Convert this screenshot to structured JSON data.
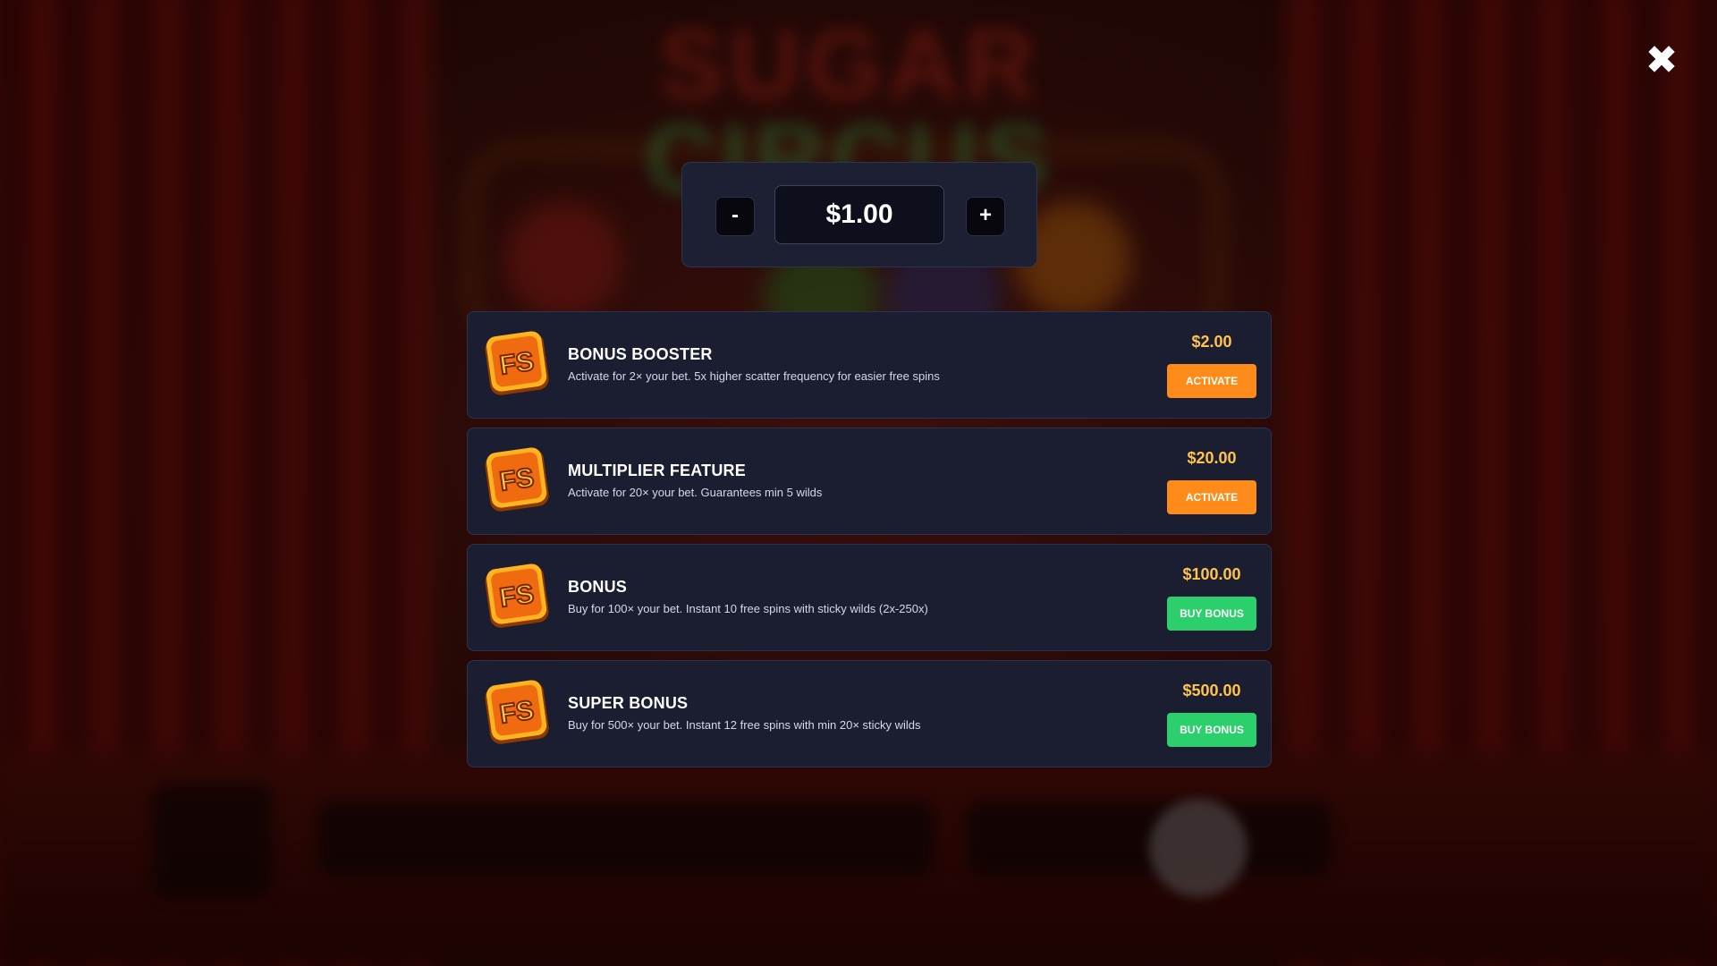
{
  "background": {
    "logo_lines": [
      "SUGAR",
      "CIRCUS"
    ]
  },
  "close": {
    "icon": "close-icon",
    "glyph": "✖"
  },
  "bet": {
    "minus_label": "-",
    "plus_label": "+",
    "value": "$1.00"
  },
  "features": [
    {
      "icon": "fs-icon",
      "icon_text": "FS",
      "title": "BONUS BOOSTER",
      "description": "Activate for 2× your bet. 5x higher scatter frequency for easier free spins",
      "price": "$2.00",
      "button": "ACTIVATE",
      "button_color": "#ff8c1a"
    },
    {
      "icon": "fs-icon",
      "icon_text": "FS",
      "title": "MULTIPLIER FEATURE",
      "description": "Activate for 20× your bet. Guarantees min 5 wilds",
      "price": "$20.00",
      "button": "ACTIVATE",
      "button_color": "#ff8c1a"
    },
    {
      "icon": "fs-icon",
      "icon_text": "FS",
      "title": "BONUS",
      "description": "Buy for 100× your bet. Instant 10 free spins with sticky wilds (2x-250x)",
      "price": "$100.00",
      "button": "BUY BONUS",
      "button_color": "#2bcf6c"
    },
    {
      "icon": "fs-icon",
      "icon_text": "FS",
      "title": "SUPER BONUS",
      "description": "Buy for 500× your bet. Instant 12 free spins with min 20× sticky wilds",
      "price": "$500.00",
      "button": "BUY BONUS",
      "button_color": "#2bcf6c"
    }
  ],
  "colors": {
    "accent_orange": "#ff8c1a",
    "accent_green": "#2bcf6c",
    "price_gold": "#ffc44a",
    "panel": "#1b1d31"
  }
}
